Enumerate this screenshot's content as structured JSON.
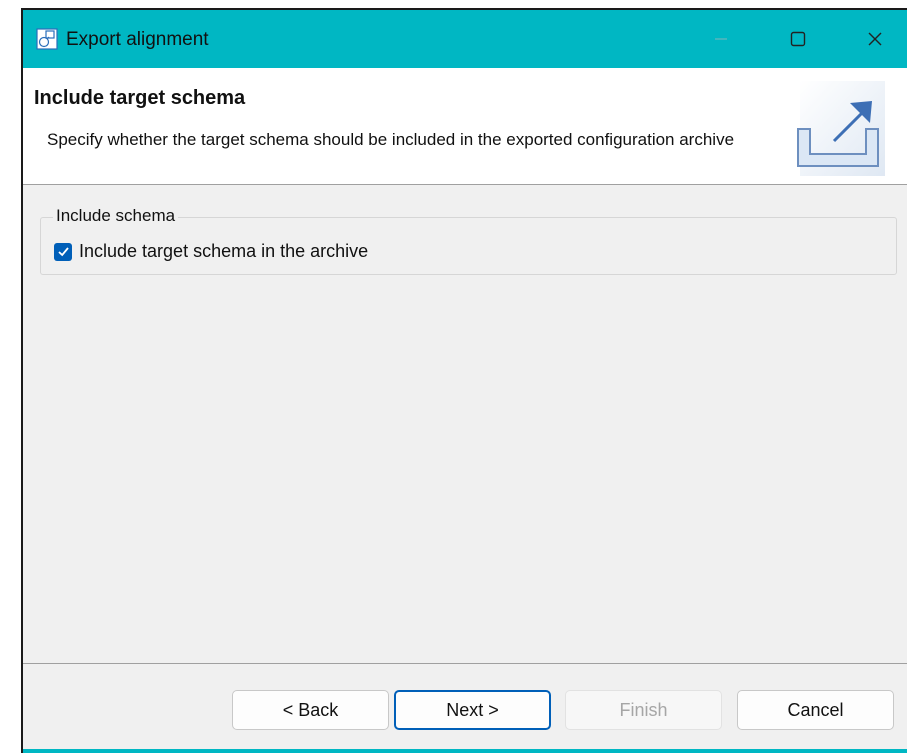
{
  "window": {
    "title": "Export alignment",
    "accent_color": "#00b7c3",
    "icons": {
      "app": "wizard-app-icon",
      "minimize": "minimize-icon",
      "maximize": "maximize-icon",
      "close": "close-icon"
    }
  },
  "header": {
    "title": "Include target schema",
    "description": "Specify whether the target schema should be included in the exported configuration archive",
    "icon": "export-icon"
  },
  "group": {
    "label": "Include schema",
    "checkbox": {
      "label": "Include target schema in the archive",
      "checked": true,
      "color": "#005fb8"
    }
  },
  "buttons": {
    "back": "< Back",
    "next": "Next >",
    "finish": "Finish",
    "cancel": "Cancel",
    "finish_enabled": false,
    "default_button": "next"
  }
}
